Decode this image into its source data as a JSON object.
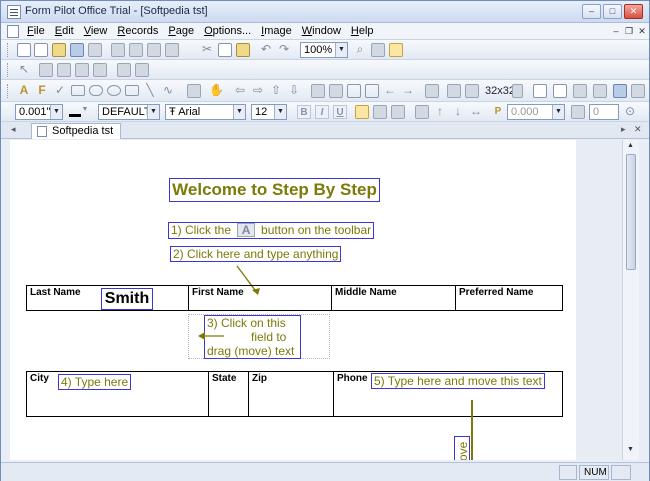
{
  "window": {
    "title": "Form Pilot Office Trial - [Softpedia tst]",
    "buttons": {
      "minimize": "–",
      "maximize": "□",
      "close": "✕"
    }
  },
  "menu": {
    "items": [
      "File",
      "Edit",
      "View",
      "Records",
      "Page",
      "Options...",
      "Image",
      "Window",
      "Help"
    ],
    "mdi": {
      "minimize": "–",
      "restore": "❐",
      "close": "✕"
    }
  },
  "toolbar": {
    "zoom": "100%",
    "icon_size": "32x32"
  },
  "format_bar": {
    "line_width": "0.001\"",
    "style": "DEFAULT",
    "font": "Arial",
    "font_size": "12",
    "font_prefix": "Ŧ",
    "bold": "B",
    "italic": "I",
    "underline": "U",
    "p_label": "P",
    "p_value": "0.000",
    "offset_value": "0"
  },
  "tabs": {
    "active": "Softpedia tst",
    "nav_left": "◂",
    "nav_right": "▸",
    "close": "✕"
  },
  "form": {
    "heading": "Welcome to Step By Step",
    "step1_before": "1) Click the",
    "step1_icon": "A",
    "step1_after": "button on the toolbar",
    "step2": "2) Click here and type anything",
    "step3_line1": "3) Click on this",
    "step3_line2": "field to",
    "step3_line3": "drag (move) text",
    "step4": "4) Type here",
    "step5": "5) Type here and move this text",
    "move_fragment": "ove",
    "last_name_label": "Last Name",
    "last_name_value": "Smith",
    "first_name_label": "First Name",
    "middle_name_label": "Middle Name",
    "preferred_name_label": "Preferred Name",
    "city_label": "City",
    "state_label": "State",
    "zip_label": "Zip",
    "phone_label": "Phone"
  },
  "status": {
    "num": "NUM"
  },
  "colors": {
    "annotation": "#7c7a09",
    "box_border": "#3b37d6"
  }
}
